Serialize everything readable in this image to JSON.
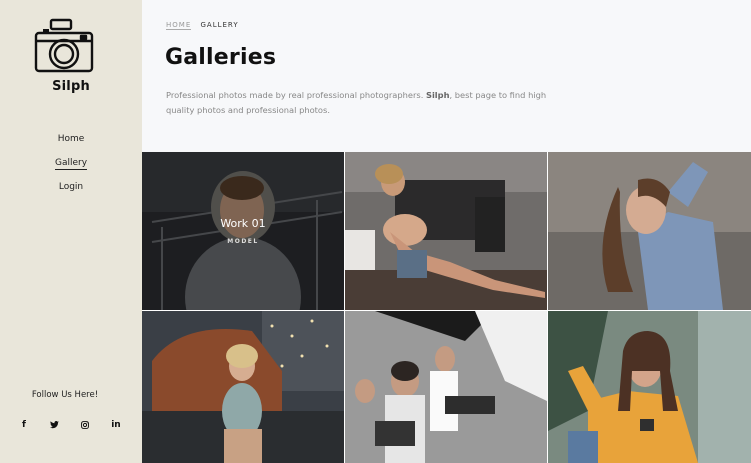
{
  "sidebar": {
    "brand": "Silph",
    "nav": [
      {
        "label": "Home"
      },
      {
        "label": "Gallery"
      },
      {
        "label": "Login"
      }
    ],
    "follow": "Follow Us Here!",
    "social": [
      "f",
      "twitter-icon",
      "instagram-icon",
      "in"
    ]
  },
  "header": {
    "breadcrumb_home": "HOME",
    "breadcrumb_current": "GALLERY",
    "title": "Galleries",
    "desc_prefix": "Professional photos made by real professional photographers. ",
    "desc_brand": "Silph",
    "desc_suffix": ", best page to find high quality photos and professional photos."
  },
  "gallery": {
    "featured_title": "Work 01",
    "featured_caption": "MODEL"
  },
  "colors": {
    "sidebar_bg": "#e9e6da",
    "header_bg": "#f7f8fa"
  }
}
